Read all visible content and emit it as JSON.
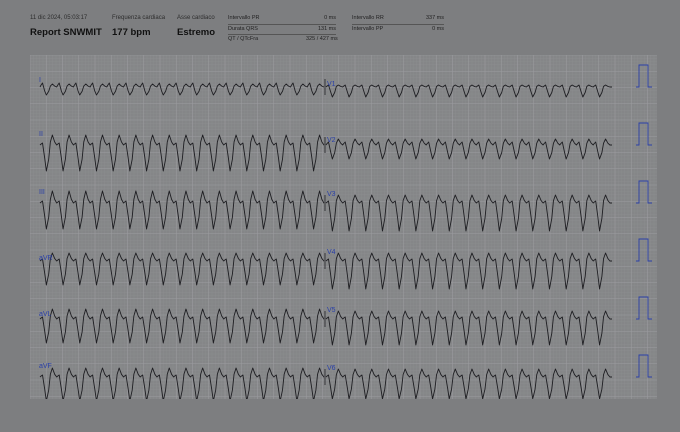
{
  "header": {
    "datetime": "11 dic 2024, 05:03:17",
    "report_title": "Report SNWMIT",
    "heart_rate": {
      "label": "Frequenza cardiaca",
      "value": "177 bpm"
    },
    "axis": {
      "label": "Asse cardiaco",
      "value": "Estremo"
    },
    "measurements_left": [
      {
        "label": "Intervallo PR",
        "value": "0 ms"
      },
      {
        "label": "Durata QRS",
        "value": "131 ms"
      },
      {
        "label": "QT / QTcFra",
        "value": "325 / 427 ms"
      }
    ],
    "measurements_right": [
      {
        "label": "Intervallo RR",
        "value": "337 ms"
      },
      {
        "label": "Intervallo PP",
        "value": "0 ms"
      }
    ]
  },
  "ecg": {
    "leads_left": [
      "I",
      "II",
      "III",
      "aVR",
      "aVL",
      "aVF"
    ],
    "leads_right": [
      "V1",
      "V2",
      "V3",
      "V4",
      "V5",
      "V6"
    ],
    "colors": {
      "paper": "#858688",
      "grid_minor": "#8f9092",
      "grid_major": "#9b9c9f",
      "trace": "#1e1e22",
      "label": "#2a40a8",
      "calibration": "#2a40a8"
    }
  }
}
